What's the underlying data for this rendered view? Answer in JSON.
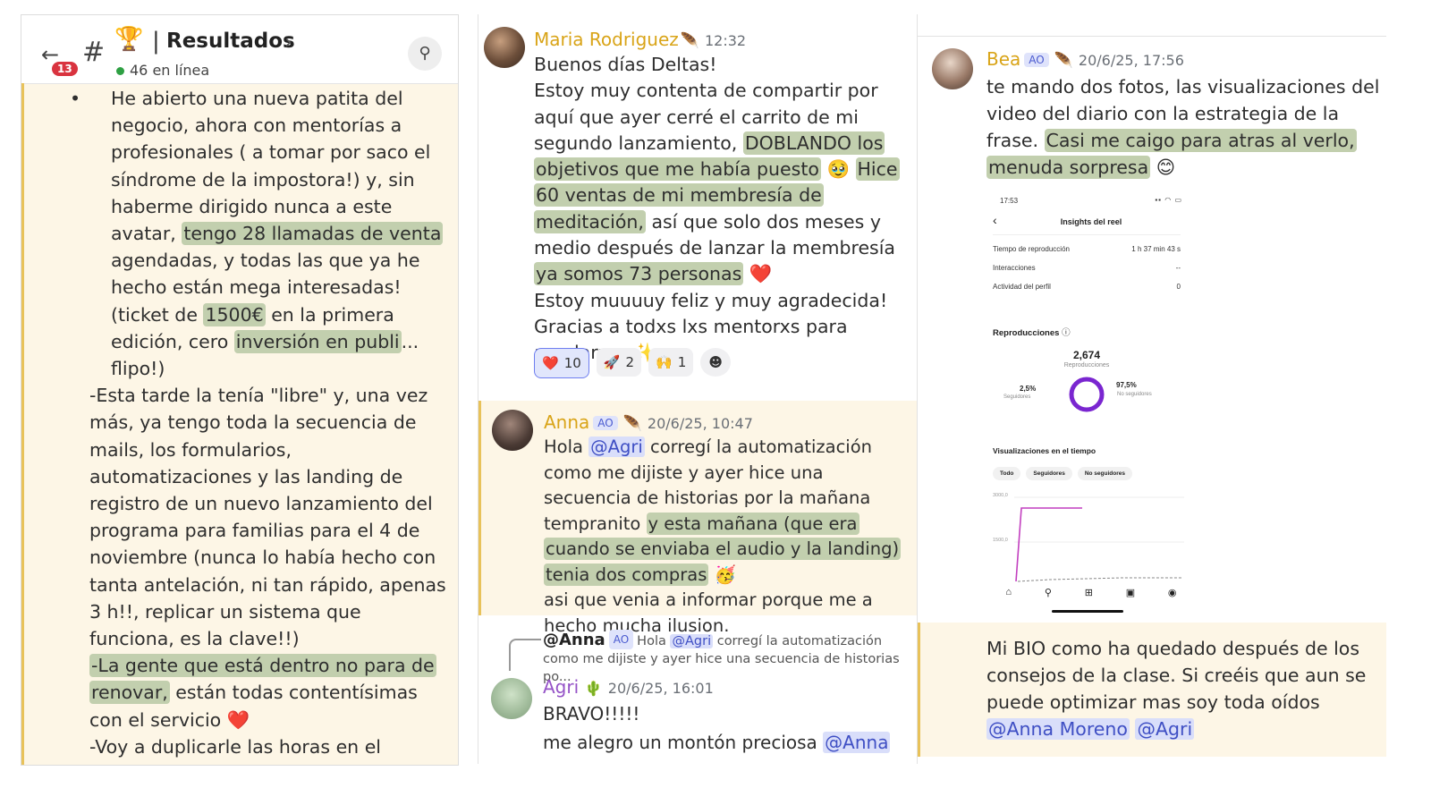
{
  "panel1": {
    "notification_count": "13",
    "channel_title": "Resultados",
    "online": "46 en línea",
    "bullet_pre": "He abierto una nueva patita del negocio, ahora con mentorías a profesionales ( a tomar por saco el síndrome de la impostora!) y, sin haberme dirigido nunca a este avatar, ",
    "bullet_hl1": "tengo 28 llamadas de venta",
    "bullet_mid1": " agendadas, y todas las que ya he hecho están mega interesadas! (ticket de ",
    "bullet_hl2": "1500€",
    "bullet_mid2": " en la primera edición, cero ",
    "bullet_hl3": "inversión en publi",
    "bullet_post": "... flipo!)",
    "para2": "-Esta tarde la tenía \"libre\" y, una vez más, ya tengo toda la secuencia de mails, los formularios, automatizaciones y las landing de registro de un nuevo lanzamiento del programa para familias para el 4 de noviembre (nunca lo había hecho con tanta antelación, ni tan rápido, apenas 3 h!!, replicar un sistema que funciona, es la clave!!)",
    "para3_hl": "-La gente que está dentro no para de renovar,",
    "para3_post": " están todas contentísimas con el servicio",
    "para4": "-Voy a duplicarle las horas en el contrato a mi empleada (esto me hace mucha ilusión)"
  },
  "panel2": {
    "maria": {
      "name": "Maria Rodriguez",
      "time": "12:32",
      "t1": "Buenos días Deltas!",
      "t2": "Estoy muy contenta de compartir por aquí que ayer cerré el carrito de mi segundo lanzamiento, ",
      "hl1": "DOBLANDO los objetivos que me había puesto",
      "t3": " ",
      "hl2": "Hice 60 ventas de mi membresía de meditación,",
      "t4": " así que solo dos meses y medio después de lanzar la membresía ",
      "hl3": "ya somos 73 personas",
      "t5": "Estoy muuuuy feliz y muy agradecida!",
      "t6": "Gracias a todxs lxs mentorxs para ayudarme",
      "reactions": [
        {
          "emoji": "❤️",
          "count": "10"
        },
        {
          "emoji": "🚀",
          "count": "2"
        },
        {
          "emoji": "🙌",
          "count": "1"
        }
      ]
    },
    "anna": {
      "name": "Anna",
      "badge": "AO",
      "time": "20/6/25, 10:47",
      "t1": "Hola ",
      "mention": "@Agri",
      "t2": " corregí la automatización como me dijiste y ayer hice una secuencia de historias por la mañana tempranito ",
      "hl": "y esta mañana (que era cuando se enviaba el audio y la landing) tenia dos compras",
      "t3": "asi que venia a informar porque me a hecho mucha ilusion."
    },
    "reply": {
      "user": "@Anna",
      "badge": "AO",
      "text_pre": "Hola ",
      "mention": "@Agri",
      "text_post": " corregí la automatización como me dijiste y ayer hice una secuencia de historias po..."
    },
    "agri": {
      "name": "Agri",
      "time": "20/6/25, 16:01",
      "line1": "BRAVO!!!!!",
      "line2": "me alegro un montón preciosa ",
      "mention": "@Anna"
    }
  },
  "panel3": {
    "bea": {
      "name": "Bea",
      "badge": "AO",
      "time": "20/6/25, 17:56",
      "t1": "te mando dos fotos, las visualizaciones del video del diario con la estrategia de la frase. ",
      "hl": "Casi me caigo para atras al verlo, menuda sorpresa"
    },
    "phone": {
      "clock": "17:53",
      "title": "Insights del reel",
      "rows": [
        {
          "label": "Tiempo de reproducción",
          "value": "1 h 37 min 43 s"
        },
        {
          "label": "Interacciones",
          "value": "--"
        },
        {
          "label": "Actividad del perfil",
          "value": "0"
        }
      ],
      "repro_title": "Reproducciones",
      "total": "2,674",
      "total_label": "Reproducciones",
      "left_pct": "2,5%",
      "left_label": "Seguidores",
      "right_pct": "97,5%",
      "right_label": "No seguidores",
      "over_time": "Visualizaciones en el tiempo",
      "tabs": [
        "Todo",
        "Seguidores",
        "No seguidores"
      ],
      "y_top": "3000,0",
      "y_mid": "1500,0"
    },
    "bio": {
      "t1": "Mi BIO como ha quedado después de los consejos de la clase. Si creéis que aun se puede optimizar mas soy toda oídos ",
      "m1": "@Anna Moreno",
      "m2": "@Agri"
    }
  }
}
